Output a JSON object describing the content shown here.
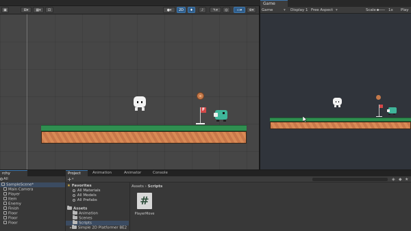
{
  "scene_toolbar": {
    "buttons": [
      "2D"
    ]
  },
  "game_panel": {
    "tab_label": "Game",
    "mode": "Game",
    "display": "Display 1",
    "aspect": "Free Aspect",
    "scale_label": "Scale",
    "scale_value": "1x",
    "play_label": "Play"
  },
  "sprites": {
    "flag_letter": "F"
  },
  "bottom_tabs": {
    "hierarchy": "rchy",
    "project": "Project",
    "animation": "Animation",
    "animator": "Animator",
    "console": "Console"
  },
  "hierarchy": {
    "search_placeholder": "All",
    "scene": "SampleScene*",
    "items": [
      "Main Camera",
      "Player",
      "Item",
      "Enemy",
      "Finish",
      "Floor",
      "Floor",
      "Floor"
    ]
  },
  "project": {
    "add_label": "+",
    "favorites_label": "Favorites",
    "favorites": [
      "All Materials",
      "All Models",
      "All Prefabs"
    ],
    "assets_label": "Assets",
    "assets": [
      "Animation",
      "Scenes",
      "Scripts",
      "Simple 2D Platformer BE2"
    ],
    "breadcrumb_root": "Assets",
    "breadcrumb_sep": "›",
    "breadcrumb_current": "Scripts",
    "file_symbol": "#",
    "file_name": "PlayerMove"
  },
  "colors": {
    "accent": "#3e78b0",
    "grass": "#2f8f50",
    "dirt": "#c8784a",
    "scene_bg": "#464646",
    "game_bg": "#30343b"
  }
}
